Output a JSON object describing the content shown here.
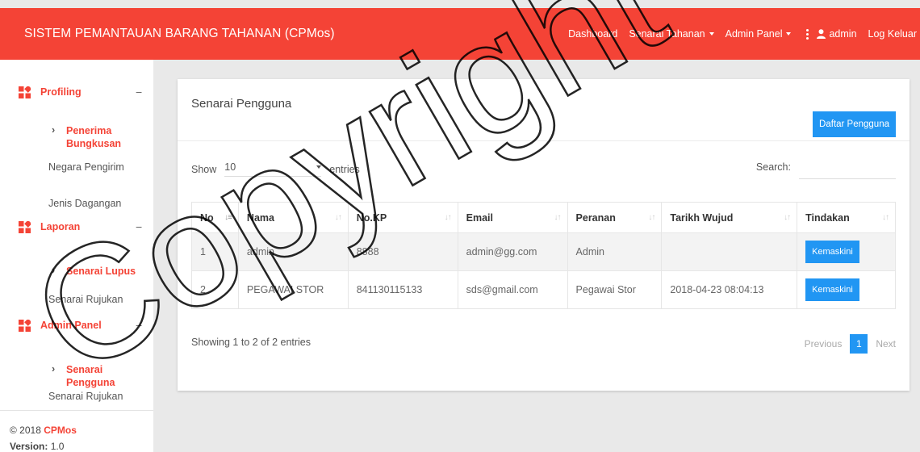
{
  "header": {
    "brand": "SISTEM PEMANTAUAN BARANG TAHANAN (CPMos)",
    "nav": {
      "dashboard": "Dashboard",
      "senarai_tahanan": "Senarai Tahanan",
      "admin_panel": "Admin Panel",
      "user": "admin",
      "logout": "Log Keluar"
    },
    "color": "#f44336"
  },
  "sidebar": {
    "sections": [
      {
        "label": "Profiling",
        "icon": "grid-icon",
        "toggle": "−",
        "sub": [
          {
            "label": "Penerima Bungkusan",
            "active": true
          }
        ],
        "plain": [
          "Negara Pengirim",
          "Jenis Dagangan"
        ]
      },
      {
        "label": "Laporan",
        "icon": "grid-icon",
        "toggle": "−",
        "sub": [
          {
            "label": "Senarai Lupus",
            "active": true
          }
        ],
        "plain": [
          "Senarai Rujukan"
        ]
      },
      {
        "label": "Admin Panel",
        "icon": "grid-icon",
        "toggle": "−",
        "sub": [
          {
            "label": "Senarai Pengguna",
            "active": true
          }
        ],
        "plain": [
          "Senarai Rujukan"
        ]
      }
    ],
    "footer": {
      "copyright": "© 2018",
      "brand": "CPMos",
      "version_label": "Version:",
      "version": "1.0"
    }
  },
  "main": {
    "title": "Senarai Pengguna",
    "add_button": "Daftar Pengguna",
    "length": {
      "show": "Show",
      "value": "10",
      "entries": "entries"
    },
    "search_label": "Search:",
    "search_value": "",
    "table": {
      "columns": [
        "No",
        "Nama",
        "No.KP",
        "Email",
        "Peranan",
        "Tarikh Wujud",
        "Tindakan"
      ],
      "rows": [
        [
          "1",
          "admin",
          "8888",
          "admin@gg.com",
          "Admin",
          "",
          "Kemaskini"
        ],
        [
          "2",
          "PEGAWAI STOR",
          "841130115133",
          "sds@gmail.com",
          "Pegawai Stor",
          "2018-04-23 08:04:13",
          "Kemaskini"
        ]
      ]
    },
    "info": "Showing 1 to 2 of 2 entries",
    "pagination": {
      "previous": "Previous",
      "current": "1",
      "next": "Next"
    },
    "accent": "#2196f3"
  },
  "watermark": {
    "text": "Copyright"
  }
}
